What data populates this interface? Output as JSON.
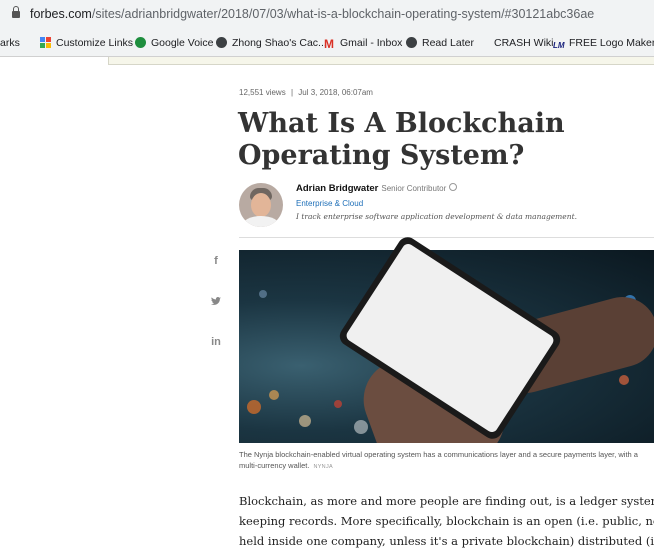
{
  "browser": {
    "url_domain": "forbes.com",
    "url_path": "/sites/adrianbridgwater/2018/07/03/what-is-a-blockchain-operating-system/#30121abc36ae",
    "bookmarks": [
      {
        "label": "arks",
        "icon": ""
      },
      {
        "label": "Customize Links",
        "icon": "grid-icon"
      },
      {
        "label": "Google Voice",
        "icon": "google-voice-icon"
      },
      {
        "label": "Zhong Shao's Cac...",
        "icon": "globe-icon"
      },
      {
        "label": "Gmail - Inbox",
        "icon": "gmail-icon"
      },
      {
        "label": "Read Later",
        "icon": "globe-icon"
      },
      {
        "label": "CRASH Wiki",
        "icon": ""
      },
      {
        "label": "FREE Logo Maker...",
        "icon": "logo-maker-icon"
      }
    ],
    "gmail_glyph": "M",
    "lm_glyph": "LM"
  },
  "article": {
    "views": "12,551 views",
    "separator": "|",
    "date": "Jul 3, 2018, 06:07am",
    "title": "What Is A Blockchain Operating System?",
    "author_name": "Adrian Bridgwater",
    "author_role": "Senior Contributor",
    "author_section": "Enterprise & Cloud",
    "author_bio": "I track enterprise software application development & data management.",
    "social": {
      "facebook": "f",
      "twitter": "t",
      "linkedin": "in"
    },
    "caption": "The Nynja blockchain-enabled virtual operating system has a communications layer and a secure payments layer, with a multi-currency wallet.",
    "credit": "NYNJA",
    "body_lines": [
      "Blockchain, as more and more people are finding out, is a ledger system for",
      "keeping records. More specifically, blockchain is an open (i.e. public, not",
      "held inside one company, unless it's a private blockchain) distributed (it"
    ]
  }
}
